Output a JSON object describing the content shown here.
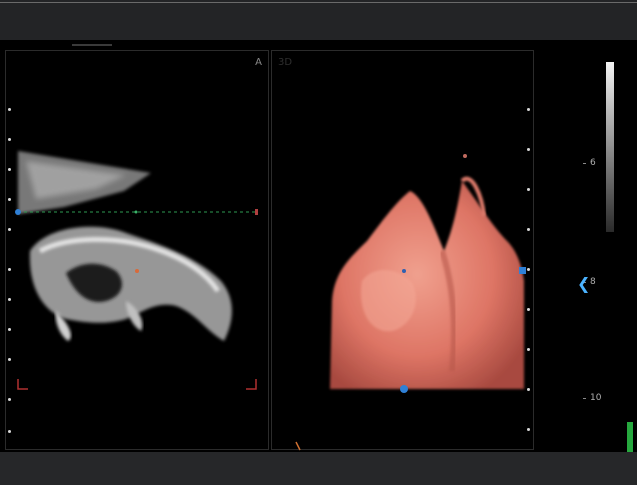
{
  "panes": {
    "left": {
      "label": "A"
    },
    "right": {
      "label": "3D"
    }
  },
  "scale": {
    "labels": [
      "6",
      "8",
      "10"
    ]
  },
  "colors": {
    "background": "#000000",
    "render_skin": "#e1786a",
    "accent_blue": "#2f80d6",
    "status_green": "#26a83e"
  }
}
